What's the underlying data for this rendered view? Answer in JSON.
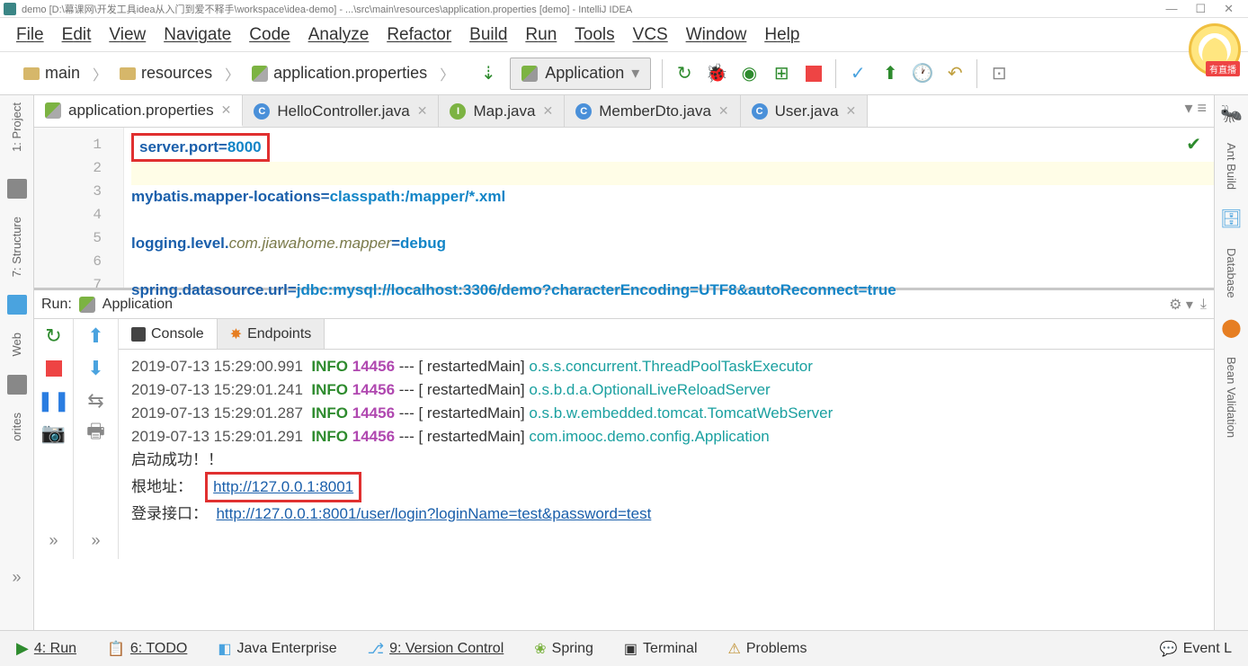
{
  "titlebar": {
    "text": "demo [D:\\幕课网\\开发工具idea从入门到爱不释手\\workspace\\idea-demo] - ...\\src\\main\\resources\\application.properties [demo] - IntelliJ IDEA"
  },
  "avatar_badge": "有直播",
  "menubar": [
    "File",
    "Edit",
    "View",
    "Navigate",
    "Code",
    "Analyze",
    "Refactor",
    "Build",
    "Run",
    "Tools",
    "VCS",
    "Window",
    "Help"
  ],
  "breadcrumb": [
    "main",
    "resources",
    "application.properties"
  ],
  "run_config": "Application",
  "file_tabs": [
    {
      "name": "application.properties",
      "type": "prop",
      "active": true
    },
    {
      "name": "HelloController.java",
      "type": "class",
      "active": false
    },
    {
      "name": "Map.java",
      "type": "interface",
      "active": false
    },
    {
      "name": "MemberDto.java",
      "type": "class",
      "active": false
    },
    {
      "name": "User.java",
      "type": "class",
      "active": false
    }
  ],
  "left_gutter": [
    "1: Project",
    "7: Structure",
    "Web",
    "orites"
  ],
  "right_gutter": [
    "Ant Build",
    "Database",
    "Bean Validation"
  ],
  "editor": {
    "line_count": 7,
    "line1_key": "server.port=",
    "line1_val": "8000",
    "line3_key": "mybatis.mapper-locations=",
    "line3_val": "classpath:/mapper/*.xml",
    "line5_key": "logging.level.",
    "line5_em": "com.jiawahome.mapper",
    "line5_rest": "=",
    "line5_val": "debug",
    "line7_key": "spring.datasource.url=",
    "line7_val": "jdbc:mysql://localhost:3306/demo?characterEncoding=UTF8&autoReconnect=true"
  },
  "run_panel": {
    "title": "Run:",
    "config": "Application",
    "tabs": [
      "Console",
      "Endpoints"
    ],
    "logs": [
      {
        "time": "2019-07-13 15:29:00.991",
        "level": "INFO",
        "pid": "14456",
        "sep": "--- [",
        "thread": "  restartedMain]",
        "cls": "o.s.s.concurrent.ThreadPoolTaskExecutor"
      },
      {
        "time": "2019-07-13 15:29:01.241",
        "level": "INFO",
        "pid": "14456",
        "sep": "--- [",
        "thread": "  restartedMain]",
        "cls": "o.s.b.d.a.OptionalLiveReloadServer"
      },
      {
        "time": "2019-07-13 15:29:01.287",
        "level": "INFO",
        "pid": "14456",
        "sep": "--- [",
        "thread": "  restartedMain]",
        "cls": "o.s.b.w.embedded.tomcat.TomcatWebServer"
      },
      {
        "time": "2019-07-13 15:29:01.291",
        "level": "INFO",
        "pid": "14456",
        "sep": "--- [",
        "thread": "  restartedMain]",
        "cls": "com.imooc.demo.config.Application"
      }
    ],
    "extra": {
      "success": "启动成功！！",
      "root_label": "根地址：",
      "root_url": "http://127.0.0.1:8001",
      "login_label": "登录接口：",
      "login_url": "http://127.0.0.1:8001/user/login?loginName=test&password=test"
    }
  },
  "bottom_bar": [
    "4: Run",
    "6: TODO",
    "Java Enterprise",
    "9: Version Control",
    "Spring",
    "Terminal",
    "Problems",
    "Event L"
  ]
}
